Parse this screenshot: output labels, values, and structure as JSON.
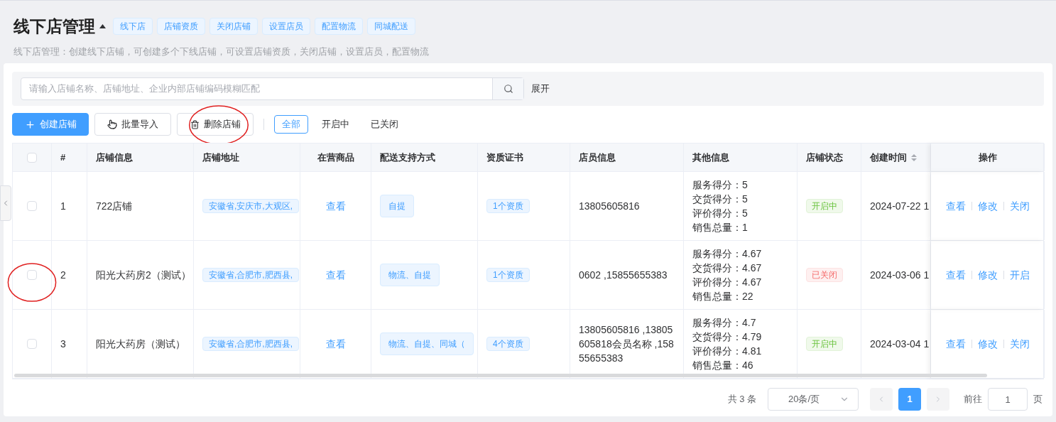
{
  "header": {
    "title": "线下店管理",
    "tags": [
      "线下店",
      "店铺资质",
      "关闭店铺",
      "设置店员",
      "配置物流",
      "同城配送"
    ],
    "description": "线下店管理：创建线下店铺，可创建多个下线店铺，可设置店铺资质，关闭店铺，设置店员，配置物流"
  },
  "search": {
    "placeholder": "请输入店铺名称、店铺地址、企业内部店铺编码模糊匹配",
    "expand": "展开"
  },
  "toolbar": {
    "buttons": [
      {
        "label": "创建店铺",
        "kind": "primary",
        "circled": false
      },
      {
        "label": "批量导入",
        "kind": "import",
        "circled": false
      },
      {
        "label": "删除店铺",
        "kind": "delete",
        "circled": true
      }
    ],
    "filters": [
      {
        "label": "全部",
        "selected": true
      },
      {
        "label": "开启中",
        "selected": false
      },
      {
        "label": "已关闭",
        "selected": false
      }
    ]
  },
  "table": {
    "header_checked": false,
    "columns": [
      "#",
      "店铺信息",
      "店铺地址",
      "在营商品",
      "配送支持方式",
      "资质证书",
      "店员信息",
      "其他信息",
      "店铺状态",
      "创建时间",
      "操作"
    ],
    "rows": [
      {
        "checked": false,
        "circled": false,
        "index": "1",
        "name": "722店铺",
        "address": "安徽省,安庆市,大观区,",
        "goods": "查看",
        "delivery": "自提",
        "cert": "1个资质",
        "staff": "13805605816",
        "other": [
          "服务得分：5",
          "交货得分：5",
          "评价得分：5",
          "销售总量：1"
        ],
        "status": {
          "label": "开启中",
          "kind": "open"
        },
        "created": "2024-07-22 1",
        "actions": [
          "查看",
          "修改",
          "关闭"
        ]
      },
      {
        "checked": false,
        "circled": true,
        "index": "2",
        "name": "阳光大药房2（测试）",
        "address": "安徽省,合肥市,肥西县,",
        "goods": "查看",
        "delivery": "物流、自提",
        "cert": "1个资质",
        "staff": "0602 ,15855655383",
        "other": [
          "服务得分：4.67",
          "交货得分：4.67",
          "评价得分：4.67",
          "销售总量：22"
        ],
        "status": {
          "label": "已关闭",
          "kind": "closed"
        },
        "created": "2024-03-06 1",
        "actions": [
          "查看",
          "修改",
          "开启"
        ]
      },
      {
        "checked": false,
        "circled": false,
        "index": "3",
        "name": "阳光大药房（测试）",
        "address": "安徽省,合肥市,肥西县,",
        "goods": "查看",
        "delivery": "物流、自提、同城（",
        "cert": "4个资质",
        "staff": "13805605816 ,13805605818会员名称 ,15855655383",
        "other": [
          "服务得分：4.7",
          "交货得分：4.79",
          "评价得分：4.81",
          "销售总量：46"
        ],
        "status": {
          "label": "开启中",
          "kind": "open"
        },
        "created": "2024-03-04 1",
        "actions": [
          "查看",
          "修改",
          "关闭"
        ]
      }
    ]
  },
  "pagination": {
    "total": "共 3 条",
    "page_size": "20条/页",
    "pages": [
      {
        "label": "1",
        "selected": true
      }
    ],
    "goto_label": "前往",
    "goto_value": "1",
    "page_unit": "页"
  }
}
